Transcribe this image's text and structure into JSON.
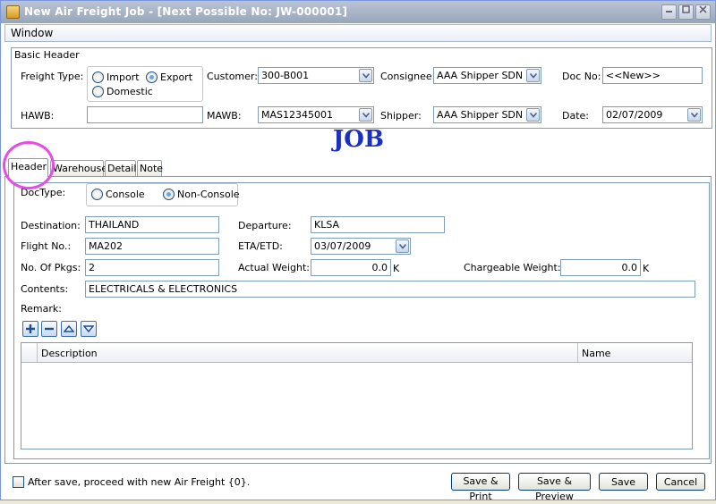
{
  "window": {
    "title": "New Air Freight Job  - [Next Possible No: JW-000001]"
  },
  "menu": {
    "window": "Window"
  },
  "basic_header": {
    "group_label": "Basic Header",
    "freight_type_label": "Freight Type:",
    "freight_options": [
      {
        "label": "Import",
        "selected": false
      },
      {
        "label": "Export",
        "selected": true
      },
      {
        "label": "Domestic",
        "selected": false
      }
    ],
    "customer_label": "Customer:",
    "customer_value": "300-B001",
    "consignee_label": "Consignee:",
    "consignee_value": "AAA Shipper SDN BH",
    "doc_no_label": "Doc No:",
    "doc_no_value": "<<New>>",
    "hawb_label": "HAWB:",
    "hawb_value": "",
    "mawb_label": "MAWB:",
    "mawb_value": "MAS12345001",
    "shipper_label": "Shipper:",
    "shipper_value": "AAA Shipper SDN BH",
    "date_label": "Date:",
    "date_value": "02/07/2009"
  },
  "banner": {
    "text": "JOB"
  },
  "tabs": [
    {
      "label": "Header",
      "active": true
    },
    {
      "label": "Warehouse",
      "active": false
    },
    {
      "label": "Detail",
      "active": false
    },
    {
      "label": "Note",
      "active": false
    }
  ],
  "header_tab": {
    "doctype_label": "DocType:",
    "doctype_options": [
      {
        "label": "Console",
        "selected": false
      },
      {
        "label": "Non-Console",
        "selected": true
      }
    ],
    "destination_label": "Destination:",
    "destination_value": "THAILAND",
    "departure_label": "Departure:",
    "departure_value": "KLSA",
    "flight_no_label": "Flight No.:",
    "flight_no_value": "MA202",
    "eta_etd_label": "ETA/ETD:",
    "eta_etd_value": "03/07/2009",
    "no_of_pkgs_label": "No. Of Pkgs:",
    "no_of_pkgs_value": "2",
    "actual_weight_label": "Actual Weight:",
    "actual_weight_value": "0.0",
    "actual_weight_unit": "K",
    "chargeable_weight_label": "Chargeable Weight:",
    "chargeable_weight_value": "0.0",
    "chargeable_weight_unit": "K",
    "contents_label": "Contents:",
    "contents_value": "ELECTRICALS & ELECTRONICS",
    "remark_label": "Remark:",
    "grid_columns": [
      "Description",
      "Name"
    ]
  },
  "footer": {
    "proceed_checkbox_label": "After save, proceed with new Air Freight {0}.",
    "proceed_checked": false,
    "buttons": {
      "save_print": "Save & Print",
      "save_preview": "Save & Preview",
      "save": "Save",
      "cancel": "Cancel"
    }
  },
  "colors": {
    "banner": "#1b2fc1",
    "highlight": "#e64ce6",
    "titlebar": "#98a6bb"
  }
}
